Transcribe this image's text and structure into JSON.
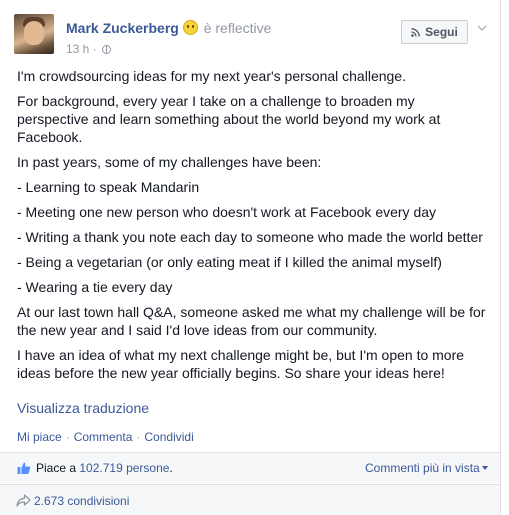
{
  "post": {
    "author": "Mark Zuckerberg",
    "feeling": "è reflective",
    "timestamp": "13 h",
    "meta_separator": "·",
    "follow_label": "Segui",
    "paragraphs": [
      "I'm crowdsourcing ideas for my next year's personal challenge.",
      "For background, every year I take on a challenge to broaden my perspective and learn something about the world beyond my work at Facebook.",
      "In past years, some of my challenges have been:",
      "- Learning to speak Mandarin",
      "- Meeting one new person who doesn't work at Facebook every day",
      "- Writing a thank you note each day to someone who made the world better",
      "- Being a vegetarian (or only eating meat if I killed the animal myself)",
      "- Wearing a tie every day",
      "At our last town hall Q&A, someone asked me what my challenge will be for the new year and I said I'd love ideas from our community.",
      "I have an idea of what my next challenge might be, but I'm open to more ideas before the new year officially begins. So share your ideas here!"
    ],
    "translate_link": "Visualizza traduzione"
  },
  "actions": {
    "like": "Mi piace",
    "comment": "Commenta",
    "share": "Condividi",
    "separator": "·"
  },
  "likes": {
    "prefix": "Piace a ",
    "count": "102.719 persone",
    "suffix": ".",
    "comments_order": "Commenti più in vista"
  },
  "shares": {
    "text": "2.673 condivisioni"
  },
  "icons": {
    "avatar": "profile-photo",
    "emoji": "smiley-icon",
    "audience": "globe-icon",
    "follow": "rss-icon",
    "menu": "chevron-down-icon",
    "like": "thumbs-up-icon",
    "share": "share-arrow-icon"
  },
  "colors": {
    "link": "#3b5998",
    "text": "#141823",
    "muted": "#9197a3",
    "bar_bg": "#f6f7f8"
  }
}
